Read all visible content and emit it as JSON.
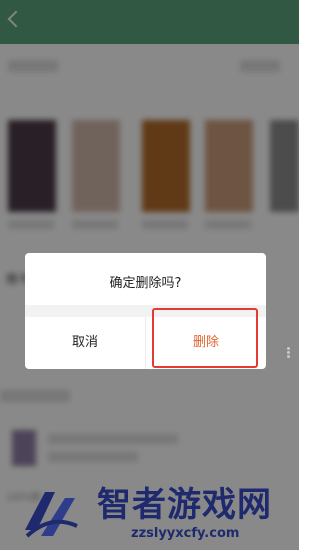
{
  "dialog": {
    "title": "确定删除吗?",
    "cancel_label": "取消",
    "delete_label": "删除"
  },
  "background": {
    "section_label": "推书",
    "small_label": "100%数"
  },
  "watermark": {
    "title": "智者游戏网",
    "url": "zzslyyxcfy.com"
  },
  "colors": {
    "accent": "#e5612f",
    "highlight": "#e53935",
    "header": "#5aa07a",
    "watermark": "#1f2a6e"
  }
}
